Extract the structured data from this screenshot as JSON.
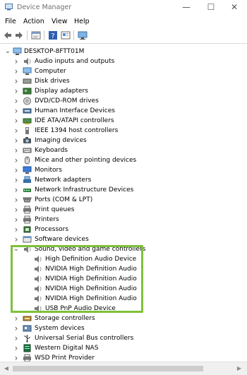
{
  "window": {
    "title": "Device Manager",
    "minimize": "—",
    "maximize": "☐",
    "close": "✕"
  },
  "menu": [
    "File",
    "Action",
    "View",
    "Help"
  ],
  "toolbar": {
    "icons": [
      "back-arrow-icon",
      "forward-arrow-icon",
      "properties-icon",
      "help-icon",
      "update-driver-icon",
      "monitor-icon"
    ]
  },
  "tree": {
    "root": "DESKTOP-8FTT01M",
    "categories": [
      {
        "label": "Audio inputs and outputs",
        "icon": "speaker-icon",
        "expanded": false
      },
      {
        "label": "Computer",
        "icon": "computer-icon",
        "expanded": false
      },
      {
        "label": "Disk drives",
        "icon": "disk-drive-icon",
        "expanded": false
      },
      {
        "label": "Display adapters",
        "icon": "display-adapter-icon",
        "expanded": false
      },
      {
        "label": "DVD/CD-ROM drives",
        "icon": "dvd-drive-icon",
        "expanded": false
      },
      {
        "label": "Human Interface Devices",
        "icon": "hid-icon",
        "expanded": false
      },
      {
        "label": "IDE ATA/ATAPI controllers",
        "icon": "ide-controller-icon",
        "expanded": false
      },
      {
        "label": "IEEE 1394 host controllers",
        "icon": "ieee1394-icon",
        "expanded": false
      },
      {
        "label": "Imaging devices",
        "icon": "camera-icon",
        "expanded": false
      },
      {
        "label": "Keyboards",
        "icon": "keyboard-icon",
        "expanded": false
      },
      {
        "label": "Mice and other pointing devices",
        "icon": "mouse-icon",
        "expanded": false
      },
      {
        "label": "Monitors",
        "icon": "monitor-icon",
        "expanded": false
      },
      {
        "label": "Network adapters",
        "icon": "network-adapter-icon",
        "expanded": false
      },
      {
        "label": "Network Infrastructure Devices",
        "icon": "network-infrastructure-icon",
        "expanded": false
      },
      {
        "label": "Ports (COM & LPT)",
        "icon": "port-icon",
        "expanded": false
      },
      {
        "label": "Print queues",
        "icon": "printer-icon",
        "expanded": false
      },
      {
        "label": "Printers",
        "icon": "printer-icon",
        "expanded": false
      },
      {
        "label": "Processors",
        "icon": "processor-icon",
        "expanded": false
      },
      {
        "label": "Software devices",
        "icon": "software-device-icon",
        "expanded": false
      },
      {
        "label": "Sound, video and game controllers",
        "icon": "speaker-icon",
        "expanded": true,
        "children": [
          "High Definition Audio Device",
          "NVIDIA High Definition Audio",
          "NVIDIA High Definition Audio",
          "NVIDIA High Definition Audio",
          "NVIDIA High Definition Audio",
          "USB PnP Audio Device"
        ]
      },
      {
        "label": "Storage controllers",
        "icon": "storage-controller-icon",
        "expanded": false
      },
      {
        "label": "System devices",
        "icon": "system-device-icon",
        "expanded": false
      },
      {
        "label": "Universal Serial Bus controllers",
        "icon": "usb-icon",
        "expanded": false
      },
      {
        "label": "Western Digital NAS",
        "icon": "nas-icon",
        "expanded": false
      },
      {
        "label": "WSD Print Provider",
        "icon": "printer-icon",
        "expanded": false
      }
    ]
  },
  "colors": {
    "highlight": "#7ec13a",
    "window_bg": "#ffffff",
    "scrollbar": "#f0f0f0"
  }
}
